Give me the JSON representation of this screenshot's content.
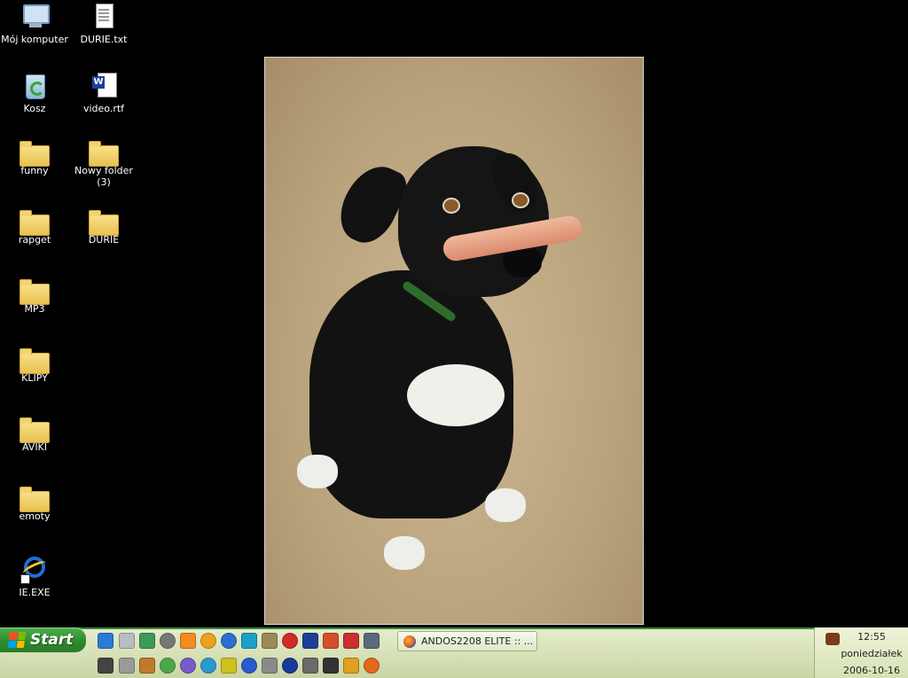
{
  "desktop": {
    "icons": [
      {
        "label": "Mój komputer",
        "type": "computer"
      },
      {
        "label": "DURIE.txt",
        "type": "text-file"
      },
      {
        "label": "Kosz",
        "type": "recycle-bin"
      },
      {
        "label": "video.rtf",
        "type": "word-document"
      },
      {
        "label": "funny",
        "type": "folder"
      },
      {
        "label": "Nowy folder (3)",
        "type": "folder"
      },
      {
        "label": "rapget",
        "type": "folder"
      },
      {
        "label": "DURIE",
        "type": "folder"
      },
      {
        "label": "MP3",
        "type": "folder"
      },
      {
        "label": "KLIPY",
        "type": "folder"
      },
      {
        "label": "AVIKI",
        "type": "folder"
      },
      {
        "label": "emoty",
        "type": "folder"
      },
      {
        "label": "IE.EXE",
        "type": "internet-explorer-shortcut"
      }
    ],
    "wallpaper": "black dog balancing a sausage on its nose"
  },
  "taskbar": {
    "start_label": "Start",
    "quick_launch_row1": [
      "ie-icon",
      "drive-icon",
      "network-icon",
      "media-icon",
      "vlc-icon",
      "sun-icon",
      "player-icon",
      "q-icon",
      "app-icon",
      "opera-icon",
      "word-icon",
      "app2-icon",
      "app3-icon",
      "app4-icon"
    ],
    "quick_launch_row2": [
      "monitor-icon",
      "photo-icon",
      "paint-icon",
      "game-icon",
      "browser-icon",
      "edge-icon",
      "winamp-icon",
      "ie2-icon",
      "hdd-icon",
      "c-icon",
      "settings-icon",
      "film-icon",
      "pencil-icon",
      "firefox-icon"
    ],
    "open_window_label": "ANDOS2208 ELITE :: ...",
    "tray": {
      "time": "12:55",
      "day": "poniedziałek",
      "date": "2006-10-16"
    }
  }
}
